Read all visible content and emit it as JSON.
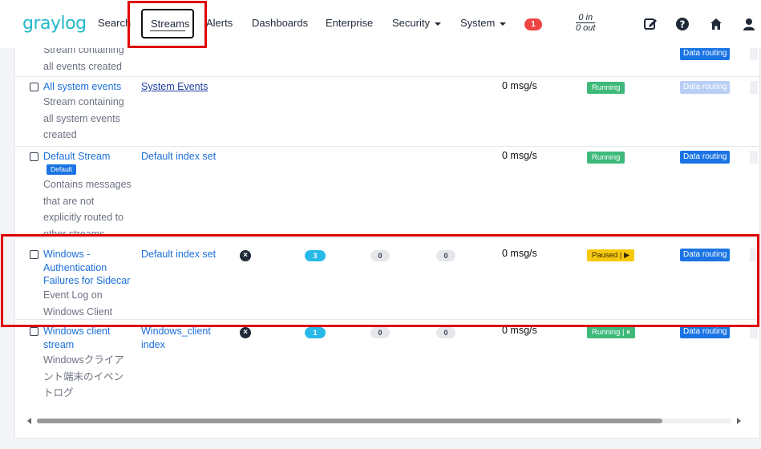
{
  "nav": {
    "logo": "graylog",
    "items": [
      "Search",
      "Streams",
      "Alerts",
      "Dashboards",
      "Enterprise",
      "Security",
      "System"
    ],
    "notification_count": "1",
    "throughput_in": "0 in",
    "throughput_out": "0 out",
    "icons": [
      "edit-icon",
      "help-icon",
      "home-icon",
      "user-icon"
    ]
  },
  "colors": {
    "brand": "#22b8c9",
    "link": "#1b6fd8",
    "running": "#3eb97a",
    "paused": "#f6c90e",
    "data_routing": "#1b74e4",
    "annotation": "#e00000"
  },
  "rows": [
    {
      "title": "",
      "description": "Stream containing all events created",
      "index": "",
      "throughput": "",
      "status": "",
      "routing": "Data routing"
    },
    {
      "title": "All system events",
      "description": "Stream containing all system events created",
      "index": "System Events",
      "throughput": "0 msg/s",
      "status": "Running",
      "routing": "Data routing"
    },
    {
      "title": "Default Stream",
      "badge": "Default",
      "description": "Contains messages that are not explicitly routed to other streams",
      "index": "Default index set",
      "throughput": "0 msg/s",
      "status": "Running",
      "routing": "Data routing"
    },
    {
      "title": "Windows - Authentication Failures for Sidecar",
      "description": "Event Log on Windows Client",
      "index": "Default index set",
      "rules_count": "3",
      "pipelines_count": "0",
      "outputs_count": "0",
      "throughput": "0 msg/s",
      "status": "Paused | ▶",
      "routing": "Data routing"
    },
    {
      "title": "Windows client stream",
      "description": "Windowsクライアント端末のイベントログ",
      "index": "Windows_client index",
      "rules_count": "1",
      "pipelines_count": "0",
      "outputs_count": "0",
      "throughput": "0 msg/s",
      "status": "Running | ⏸",
      "routing": "Data routing"
    }
  ]
}
